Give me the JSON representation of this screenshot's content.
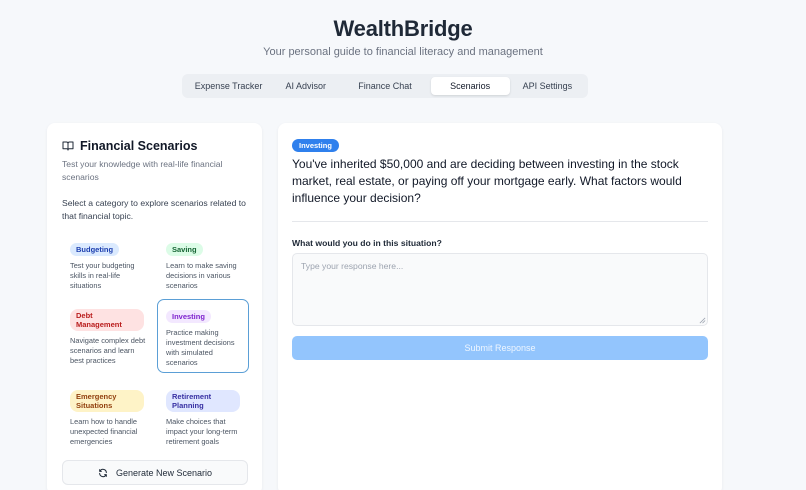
{
  "app": {
    "title": "WealthBridge",
    "subtitle": "Your personal guide to financial literacy and management"
  },
  "tabs": [
    {
      "label": "Expense Tracker",
      "active": false
    },
    {
      "label": "AI Advisor",
      "active": false
    },
    {
      "label": "Finance Chat",
      "active": false
    },
    {
      "label": "Scenarios",
      "active": true
    },
    {
      "label": "API Settings",
      "active": false
    }
  ],
  "scenarios_panel": {
    "icon": "book-open-icon",
    "title": "Financial Scenarios",
    "description": "Test your knowledge with real-life financial scenarios",
    "instruction": "Select a category to explore scenarios related to that financial topic.",
    "categories": [
      {
        "label": "Budgeting",
        "description": "Test your budgeting skills in real-life situations",
        "badge_bg": "#dbeafe",
        "badge_fg": "#1e40af",
        "selected": false
      },
      {
        "label": "Saving",
        "description": "Learn to make saving decisions in various scenarios",
        "badge_bg": "#dcfce7",
        "badge_fg": "#166534",
        "selected": false
      },
      {
        "label": "Debt Management",
        "description": "Navigate complex debt scenarios and learn best practices",
        "badge_bg": "#fee2e2",
        "badge_fg": "#b91c1c",
        "selected": false
      },
      {
        "label": "Investing",
        "description": "Practice making investment decisions with simulated scenarios",
        "badge_bg": "#f3e8ff",
        "badge_fg": "#7e22ce",
        "selected": true
      },
      {
        "label": "Emergency Situations",
        "description": "Learn how to handle unexpected financial emergencies",
        "badge_bg": "#fef3c7",
        "badge_fg": "#92400e",
        "selected": false
      },
      {
        "label": "Retirement Planning",
        "description": "Make choices that impact your long-term retirement goals",
        "badge_bg": "#e0e7ff",
        "badge_fg": "#3730a3",
        "selected": false
      }
    ],
    "generate_button": "Generate New Scenario",
    "generate_icon": "refresh-icon"
  },
  "scenario": {
    "tag": "Investing",
    "question": "You've inherited $50,000 and are deciding between investing in the stock market, real estate, or paying off your mortgage early. What factors would influence your decision?",
    "response_label": "What would you do in this situation?",
    "response_placeholder": "Type your response here...",
    "response_value": "",
    "submit_label": "Submit Response"
  },
  "colors": {
    "accent": "#2f80ed",
    "submit_disabled": "#93c5fd",
    "selected_border": "#5b9fd6"
  }
}
